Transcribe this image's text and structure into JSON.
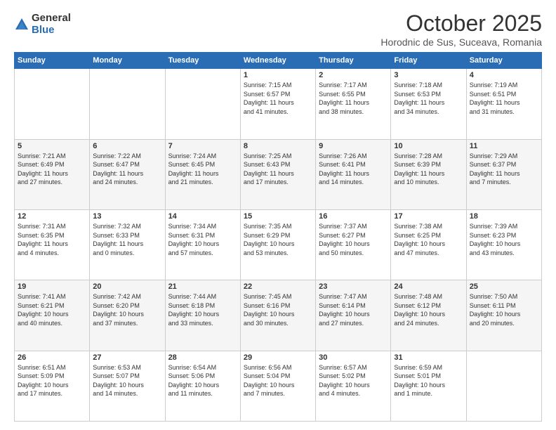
{
  "header": {
    "logo_general": "General",
    "logo_blue": "Blue",
    "month_title": "October 2025",
    "location": "Horodnic de Sus, Suceava, Romania"
  },
  "days_of_week": [
    "Sunday",
    "Monday",
    "Tuesday",
    "Wednesday",
    "Thursday",
    "Friday",
    "Saturday"
  ],
  "weeks": [
    [
      {
        "day": "",
        "info": ""
      },
      {
        "day": "",
        "info": ""
      },
      {
        "day": "",
        "info": ""
      },
      {
        "day": "1",
        "info": "Sunrise: 7:15 AM\nSunset: 6:57 PM\nDaylight: 11 hours\nand 41 minutes."
      },
      {
        "day": "2",
        "info": "Sunrise: 7:17 AM\nSunset: 6:55 PM\nDaylight: 11 hours\nand 38 minutes."
      },
      {
        "day": "3",
        "info": "Sunrise: 7:18 AM\nSunset: 6:53 PM\nDaylight: 11 hours\nand 34 minutes."
      },
      {
        "day": "4",
        "info": "Sunrise: 7:19 AM\nSunset: 6:51 PM\nDaylight: 11 hours\nand 31 minutes."
      }
    ],
    [
      {
        "day": "5",
        "info": "Sunrise: 7:21 AM\nSunset: 6:49 PM\nDaylight: 11 hours\nand 27 minutes."
      },
      {
        "day": "6",
        "info": "Sunrise: 7:22 AM\nSunset: 6:47 PM\nDaylight: 11 hours\nand 24 minutes."
      },
      {
        "day": "7",
        "info": "Sunrise: 7:24 AM\nSunset: 6:45 PM\nDaylight: 11 hours\nand 21 minutes."
      },
      {
        "day": "8",
        "info": "Sunrise: 7:25 AM\nSunset: 6:43 PM\nDaylight: 11 hours\nand 17 minutes."
      },
      {
        "day": "9",
        "info": "Sunrise: 7:26 AM\nSunset: 6:41 PM\nDaylight: 11 hours\nand 14 minutes."
      },
      {
        "day": "10",
        "info": "Sunrise: 7:28 AM\nSunset: 6:39 PM\nDaylight: 11 hours\nand 10 minutes."
      },
      {
        "day": "11",
        "info": "Sunrise: 7:29 AM\nSunset: 6:37 PM\nDaylight: 11 hours\nand 7 minutes."
      }
    ],
    [
      {
        "day": "12",
        "info": "Sunrise: 7:31 AM\nSunset: 6:35 PM\nDaylight: 11 hours\nand 4 minutes."
      },
      {
        "day": "13",
        "info": "Sunrise: 7:32 AM\nSunset: 6:33 PM\nDaylight: 11 hours\nand 0 minutes."
      },
      {
        "day": "14",
        "info": "Sunrise: 7:34 AM\nSunset: 6:31 PM\nDaylight: 10 hours\nand 57 minutes."
      },
      {
        "day": "15",
        "info": "Sunrise: 7:35 AM\nSunset: 6:29 PM\nDaylight: 10 hours\nand 53 minutes."
      },
      {
        "day": "16",
        "info": "Sunrise: 7:37 AM\nSunset: 6:27 PM\nDaylight: 10 hours\nand 50 minutes."
      },
      {
        "day": "17",
        "info": "Sunrise: 7:38 AM\nSunset: 6:25 PM\nDaylight: 10 hours\nand 47 minutes."
      },
      {
        "day": "18",
        "info": "Sunrise: 7:39 AM\nSunset: 6:23 PM\nDaylight: 10 hours\nand 43 minutes."
      }
    ],
    [
      {
        "day": "19",
        "info": "Sunrise: 7:41 AM\nSunset: 6:21 PM\nDaylight: 10 hours\nand 40 minutes."
      },
      {
        "day": "20",
        "info": "Sunrise: 7:42 AM\nSunset: 6:20 PM\nDaylight: 10 hours\nand 37 minutes."
      },
      {
        "day": "21",
        "info": "Sunrise: 7:44 AM\nSunset: 6:18 PM\nDaylight: 10 hours\nand 33 minutes."
      },
      {
        "day": "22",
        "info": "Sunrise: 7:45 AM\nSunset: 6:16 PM\nDaylight: 10 hours\nand 30 minutes."
      },
      {
        "day": "23",
        "info": "Sunrise: 7:47 AM\nSunset: 6:14 PM\nDaylight: 10 hours\nand 27 minutes."
      },
      {
        "day": "24",
        "info": "Sunrise: 7:48 AM\nSunset: 6:12 PM\nDaylight: 10 hours\nand 24 minutes."
      },
      {
        "day": "25",
        "info": "Sunrise: 7:50 AM\nSunset: 6:11 PM\nDaylight: 10 hours\nand 20 minutes."
      }
    ],
    [
      {
        "day": "26",
        "info": "Sunrise: 6:51 AM\nSunset: 5:09 PM\nDaylight: 10 hours\nand 17 minutes."
      },
      {
        "day": "27",
        "info": "Sunrise: 6:53 AM\nSunset: 5:07 PM\nDaylight: 10 hours\nand 14 minutes."
      },
      {
        "day": "28",
        "info": "Sunrise: 6:54 AM\nSunset: 5:06 PM\nDaylight: 10 hours\nand 11 minutes."
      },
      {
        "day": "29",
        "info": "Sunrise: 6:56 AM\nSunset: 5:04 PM\nDaylight: 10 hours\nand 7 minutes."
      },
      {
        "day": "30",
        "info": "Sunrise: 6:57 AM\nSunset: 5:02 PM\nDaylight: 10 hours\nand 4 minutes."
      },
      {
        "day": "31",
        "info": "Sunrise: 6:59 AM\nSunset: 5:01 PM\nDaylight: 10 hours\nand 1 minute."
      },
      {
        "day": "",
        "info": ""
      }
    ]
  ]
}
